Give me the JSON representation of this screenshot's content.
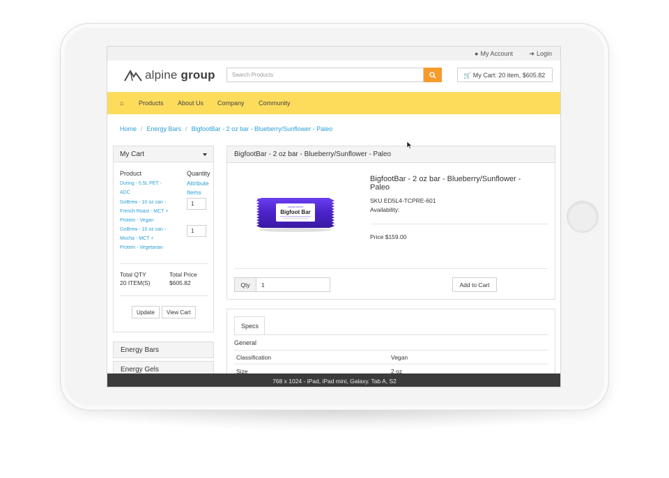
{
  "topbar": {
    "account": "My Account",
    "login": "Login"
  },
  "header": {
    "logo_light": "alpine",
    "logo_bold": "group",
    "search_placeholder": "Search Products",
    "cart_summary": "My Cart: 20 item, $605.82"
  },
  "nav": {
    "items": [
      "Products",
      "About Us",
      "Company",
      "Community"
    ]
  },
  "breadcrumb": [
    "Home",
    "Energy Bars",
    "BigfootBar - 2 oz bar - Blueberry/Sunflower - Paleo"
  ],
  "sidebar_cart": {
    "title": "My Cart",
    "col_product": "Product",
    "col_quantity": "Quantity",
    "items": [
      {
        "name_lines": [
          "During - 0.5L PET -",
          "ADC"
        ],
        "qty_lines": [
          "Attribute",
          "Items"
        ]
      },
      {
        "name_lines": [
          "GoBrew - 10 oz can -",
          "French Roast - MCT +",
          "Protein - Vegan"
        ],
        "qty": "1"
      },
      {
        "name_lines": [
          "GoBrew - 10 oz can -",
          "Mocha - MCT +",
          "Protein - Vegetarian"
        ],
        "qty": "1"
      }
    ],
    "total_qty_label": "Total QTY",
    "total_qty_value": "20 ITEM(S)",
    "total_price_label": "Total Price",
    "total_price_value": "$605.82",
    "update_label": "Update",
    "view_cart_label": "View Cart"
  },
  "categories": [
    "Energy Bars",
    "Energy Gels"
  ],
  "product": {
    "panel_title": "BigfootBar - 2 oz bar - Blueberry/Sunflower - Paleo",
    "title_lines": [
      "BigfootBar - 2 oz bar - Blueberry/Sunflower -",
      "Paleo"
    ],
    "sku": "SKU ED5L4-TCPRE-601",
    "availability": "Availability:",
    "price": "Price $159.00",
    "qty_label": "Qty",
    "qty_value": "1",
    "add_to_cart": "Add to Cart",
    "package_brand": "ALPINE GROUP",
    "package_name": "Bigfoot Bar",
    "package_color": "#5b2fd6"
  },
  "specs": {
    "tab": "Specs",
    "section": "General",
    "rows": [
      {
        "label": "Classification",
        "value": "Vegan"
      },
      {
        "label": "Size",
        "value": "2 oz"
      }
    ]
  },
  "device_bar": "768 x 1024 - iPad, iPad mini, Galaxy. Tab A, S2",
  "colors": {
    "accent": "#f79b2d",
    "nav": "#fddc5c",
    "link": "#2a9fd6",
    "bar": "#3b3b3b"
  }
}
